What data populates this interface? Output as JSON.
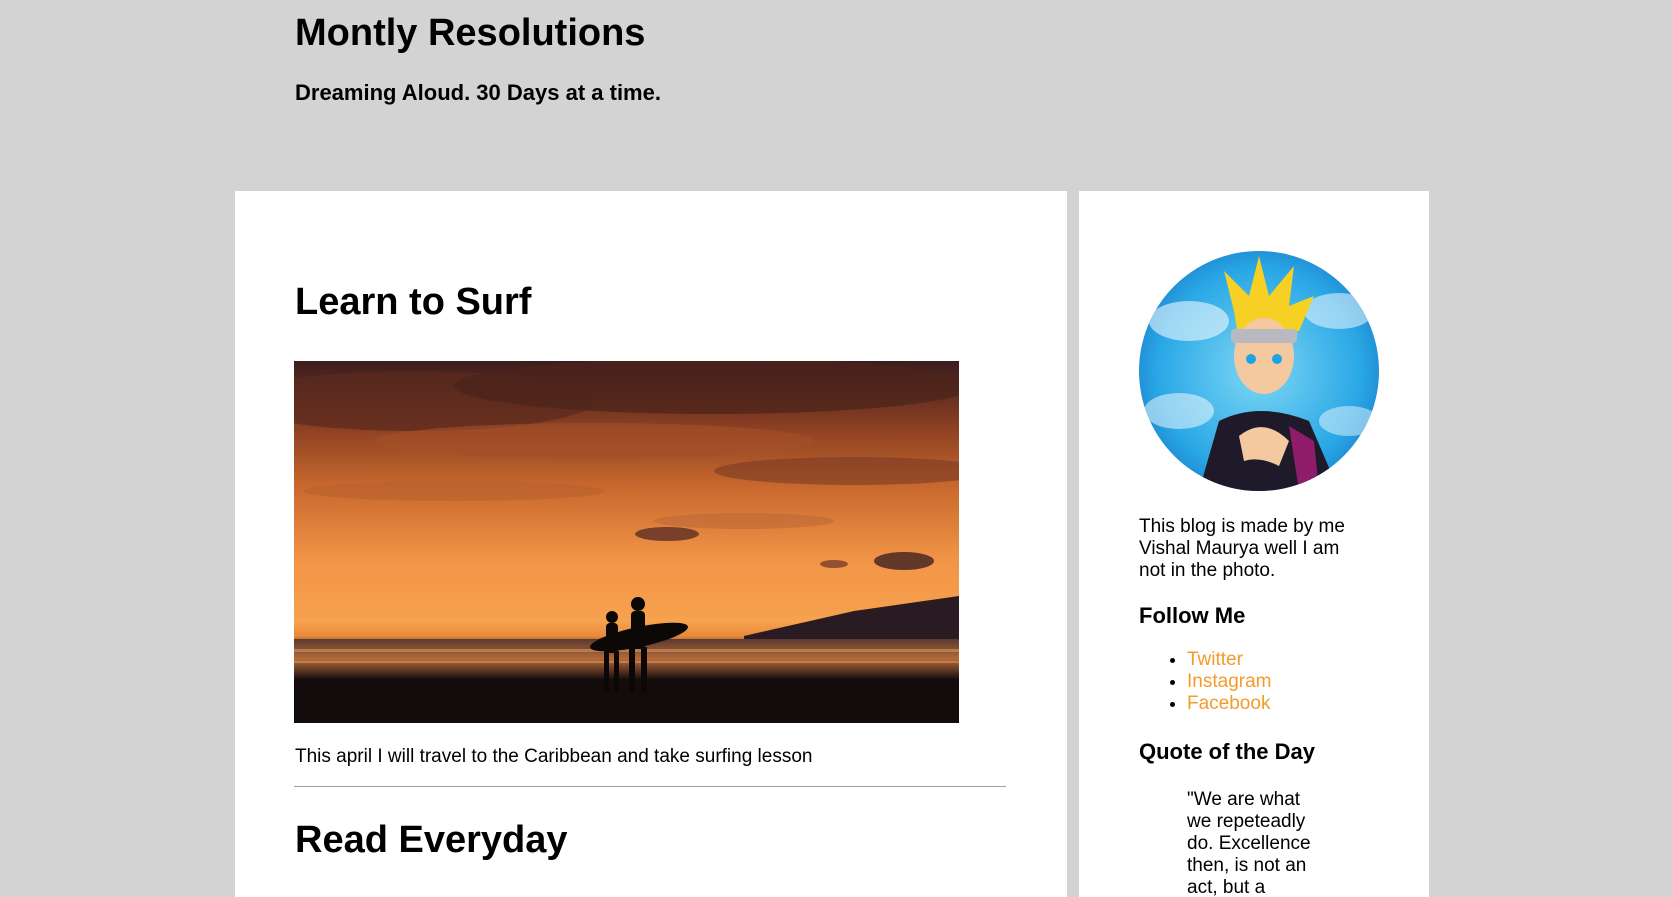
{
  "header": {
    "title": "Montly Resolutions",
    "tagline": "Dreaming Aloud. 30 Days at a time."
  },
  "posts": [
    {
      "title": "Learn to Surf",
      "text": "This april I will travel to the Caribbean and take surfing lesson"
    },
    {
      "title": "Read Everyday"
    }
  ],
  "sidebar": {
    "bio": "This blog is made by me Vishal Maurya well I am not in the photo.",
    "follow_heading": "Follow Me",
    "links": [
      "Twitter",
      "Instagram",
      "Facebook"
    ],
    "quote_heading": "Quote of the Day",
    "quote": "\"We are what we repeteadly do. Excellence then, is not an act, but a"
  },
  "colors": {
    "page_background": "#d3d3d3",
    "card_background": "#ffffff",
    "link": "#f39b2b"
  }
}
